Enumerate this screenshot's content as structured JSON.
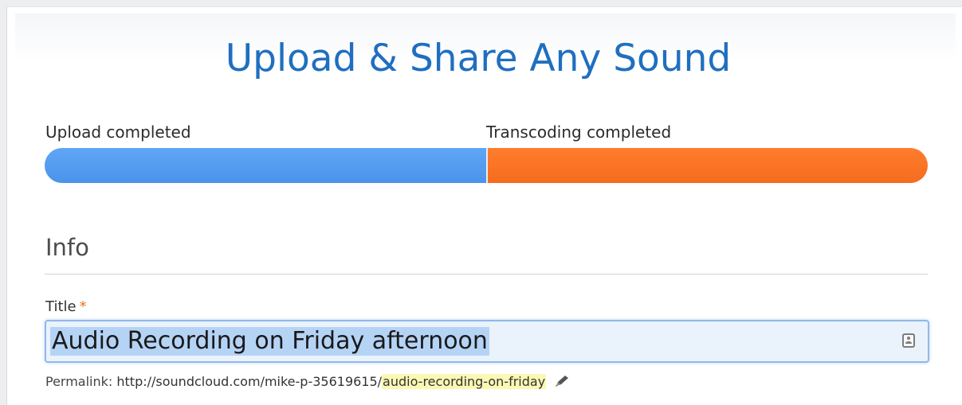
{
  "page": {
    "title": "Upload & Share Any Sound"
  },
  "progress": {
    "upload_label": "Upload completed",
    "transcode_label": "Transcoding completed",
    "upload_fraction": 0.5,
    "transcode_fraction": 0.5,
    "upload_color": "#4b93ea",
    "transcode_color": "#f56c1e"
  },
  "info": {
    "section_title": "Info",
    "title_field": {
      "label": "Title",
      "required_mark": "*",
      "value": "Audio Recording on Friday afternoon",
      "icon": "contacts-card-icon"
    },
    "permalink": {
      "label": "Permalink:",
      "base_url": "http://soundcloud.com/mike-p-35619615/",
      "slug": "audio-recording-on-friday",
      "edit_icon": "pencil-icon"
    }
  },
  "colors": {
    "title_blue": "#1f6fc0",
    "required_orange": "#e8731c",
    "slug_highlight": "#fbf8b4"
  }
}
